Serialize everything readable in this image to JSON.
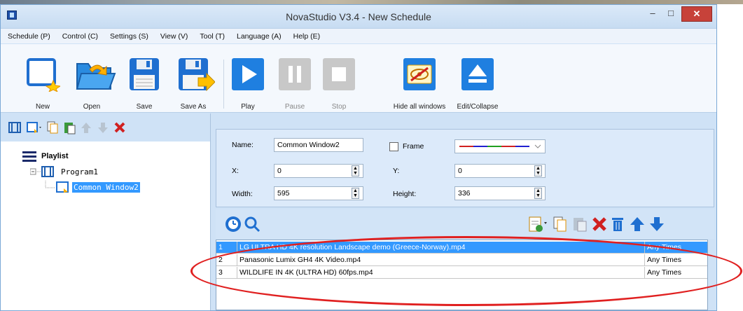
{
  "window": {
    "title": "NovaStudio V3.4 - New Schedule",
    "controls": {
      "minimize": "–",
      "maximize": "□",
      "close": "✕"
    }
  },
  "menu": [
    "Schedule (P)",
    "Control (C)",
    "Settings (S)",
    "View (V)",
    "Tool (T)",
    "Language (A)",
    "Help (E)"
  ],
  "toolbar": {
    "new": "New",
    "open": "Open",
    "save": "Save",
    "save_as": "Save As",
    "play": "Play",
    "pause": "Pause",
    "stop": "Stop",
    "hide_all": "Hide all windows",
    "edit_collapse": "Edit/Collapse"
  },
  "tree": {
    "root": "Playlist",
    "program": "Program1",
    "window": "Common Window2"
  },
  "properties": {
    "name_label": "Name:",
    "name_value": "Common Window2",
    "frame_label": "Frame",
    "x_label": "X:",
    "x_value": "0",
    "y_label": "Y:",
    "y_value": "0",
    "width_label": "Width:",
    "width_value": "595",
    "height_label": "Height:",
    "height_value": "336"
  },
  "media_list": [
    {
      "index": "1",
      "name": "LG ULTRA HD 4K resolution Landscape demo (Greece-Norway).mp4",
      "times": "Any Times",
      "selected": true
    },
    {
      "index": "2",
      "name": "Panasonic Lumix GH4 4K Video.mp4",
      "times": "Any Times",
      "selected": false
    },
    {
      "index": "3",
      "name": "WILDLIFE IN 4K (ULTRA HD) 60fps.mp4",
      "times": "Any Times",
      "selected": false
    }
  ],
  "colors": {
    "selection": "#3399ff",
    "window_bg": "#cfe2f6",
    "annotation": "#e02020",
    "close_button": "#c7423a"
  }
}
